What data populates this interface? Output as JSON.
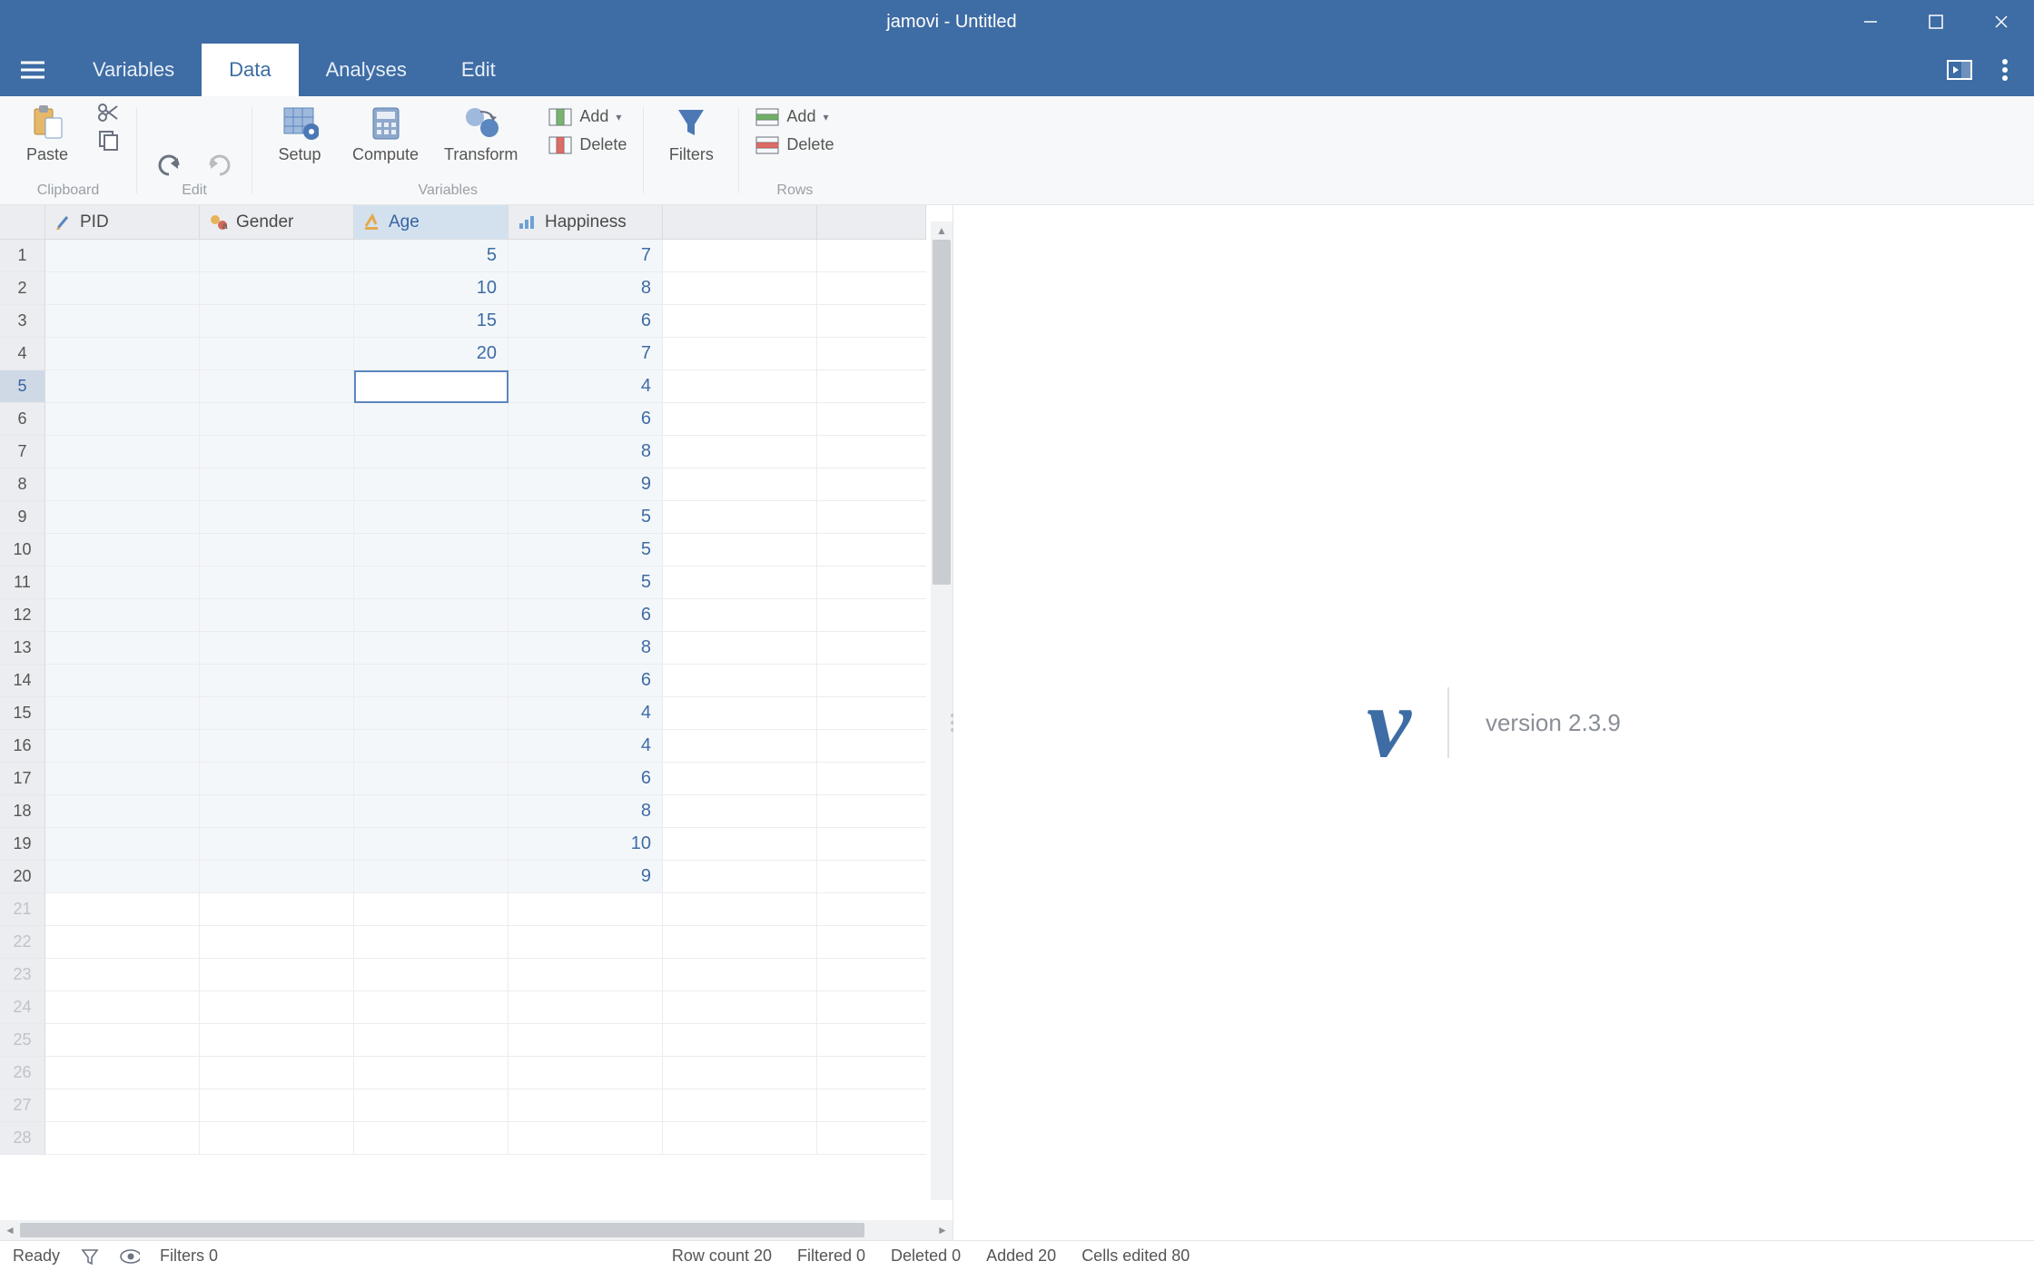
{
  "window": {
    "title": "jamovi - Untitled"
  },
  "tabs": [
    "Variables",
    "Data",
    "Analyses",
    "Edit"
  ],
  "active_tab_index": 1,
  "ribbon": {
    "clipboard": {
      "paste": "Paste",
      "group": "Clipboard"
    },
    "edit": {
      "group": "Edit"
    },
    "variables": {
      "setup": "Setup",
      "compute": "Compute",
      "transform": "Transform",
      "add": "Add",
      "delete": "Delete",
      "group": "Variables"
    },
    "filters": {
      "filters": "Filters"
    },
    "rows": {
      "add": "Add",
      "delete": "Delete",
      "group": "Rows"
    }
  },
  "columns": [
    {
      "name": "PID",
      "type": "id"
    },
    {
      "name": "Gender",
      "type": "nominal"
    },
    {
      "name": "Age",
      "type": "continuous",
      "selected": true
    },
    {
      "name": "Happiness",
      "type": "ordinal"
    }
  ],
  "selected_cell": {
    "row": 5,
    "col": 2
  },
  "row_count_visible": 28,
  "data_rows": [
    {
      "PID": "",
      "Gender": "",
      "Age": 5,
      "Happiness": 7
    },
    {
      "PID": "",
      "Gender": "",
      "Age": 10,
      "Happiness": 8
    },
    {
      "PID": "",
      "Gender": "",
      "Age": 15,
      "Happiness": 6
    },
    {
      "PID": "",
      "Gender": "",
      "Age": 20,
      "Happiness": 7
    },
    {
      "PID": "",
      "Gender": "",
      "Age": "",
      "Happiness": 4
    },
    {
      "PID": "",
      "Gender": "",
      "Age": "",
      "Happiness": 6
    },
    {
      "PID": "",
      "Gender": "",
      "Age": "",
      "Happiness": 8
    },
    {
      "PID": "",
      "Gender": "",
      "Age": "",
      "Happiness": 9
    },
    {
      "PID": "",
      "Gender": "",
      "Age": "",
      "Happiness": 5
    },
    {
      "PID": "",
      "Gender": "",
      "Age": "",
      "Happiness": 5
    },
    {
      "PID": "",
      "Gender": "",
      "Age": "",
      "Happiness": 5
    },
    {
      "PID": "",
      "Gender": "",
      "Age": "",
      "Happiness": 6
    },
    {
      "PID": "",
      "Gender": "",
      "Age": "",
      "Happiness": 8
    },
    {
      "PID": "",
      "Gender": "",
      "Age": "",
      "Happiness": 6
    },
    {
      "PID": "",
      "Gender": "",
      "Age": "",
      "Happiness": 4
    },
    {
      "PID": "",
      "Gender": "",
      "Age": "",
      "Happiness": 4
    },
    {
      "PID": "",
      "Gender": "",
      "Age": "",
      "Happiness": 6
    },
    {
      "PID": "",
      "Gender": "",
      "Age": "",
      "Happiness": 8
    },
    {
      "PID": "",
      "Gender": "",
      "Age": "",
      "Happiness": 10
    },
    {
      "PID": "",
      "Gender": "",
      "Age": "",
      "Happiness": 9
    }
  ],
  "results": {
    "version_label": "version 2.3.9"
  },
  "status": {
    "ready": "Ready",
    "filters": "Filters 0",
    "row_count": "Row count 20",
    "filtered": "Filtered 0",
    "deleted": "Deleted 0",
    "added": "Added 20",
    "cells_edited": "Cells edited 80"
  },
  "colors": {
    "brand": "#3e6ca4",
    "accent_text": "#3e6ca4"
  }
}
